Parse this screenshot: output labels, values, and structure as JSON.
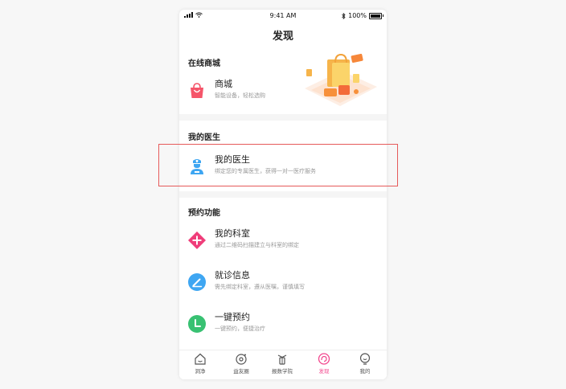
{
  "status": {
    "time": "9:41 AM",
    "battery": "100%"
  },
  "nav": {
    "title": "发现"
  },
  "sections": [
    {
      "title": "在线商城",
      "items": [
        {
          "title": "商城",
          "desc": "智能设备，轻松选购",
          "icon": "shopping-bag-icon",
          "color": "#f5556a"
        }
      ]
    },
    {
      "title": "我的医生",
      "items": [
        {
          "title": "我的医生",
          "desc": "绑定您的专属医生，获得一对一医疗服务",
          "icon": "doctor-icon",
          "color": "#3ea6f2"
        }
      ]
    },
    {
      "title": "预约功能",
      "items": [
        {
          "title": "我的科室",
          "desc": "通过二维码扫描建立与科室的绑定",
          "icon": "plus-diamond-icon",
          "color": "#ef3d7a"
        },
        {
          "title": "就诊信息",
          "desc": "需先绑定科室，遵从医嘱，谨慎填写",
          "icon": "pencil-icon",
          "color": "#3ea6f2"
        },
        {
          "title": "一键预约",
          "desc": "一键预约，便捷治疗",
          "icon": "clock-icon",
          "color": "#38c172"
        }
      ]
    }
  ],
  "tabs": [
    {
      "label": "洞净",
      "icon": "home-icon",
      "active": false
    },
    {
      "label": "益友圈",
      "icon": "circle-icon",
      "active": false
    },
    {
      "label": "报数学院",
      "icon": "academy-icon",
      "active": false
    },
    {
      "label": "发现",
      "icon": "discover-icon",
      "active": true
    },
    {
      "label": "我的",
      "icon": "profile-icon",
      "active": false
    }
  ],
  "colors": {
    "accent": "#f2478e",
    "highlight": "#e65a5a"
  }
}
